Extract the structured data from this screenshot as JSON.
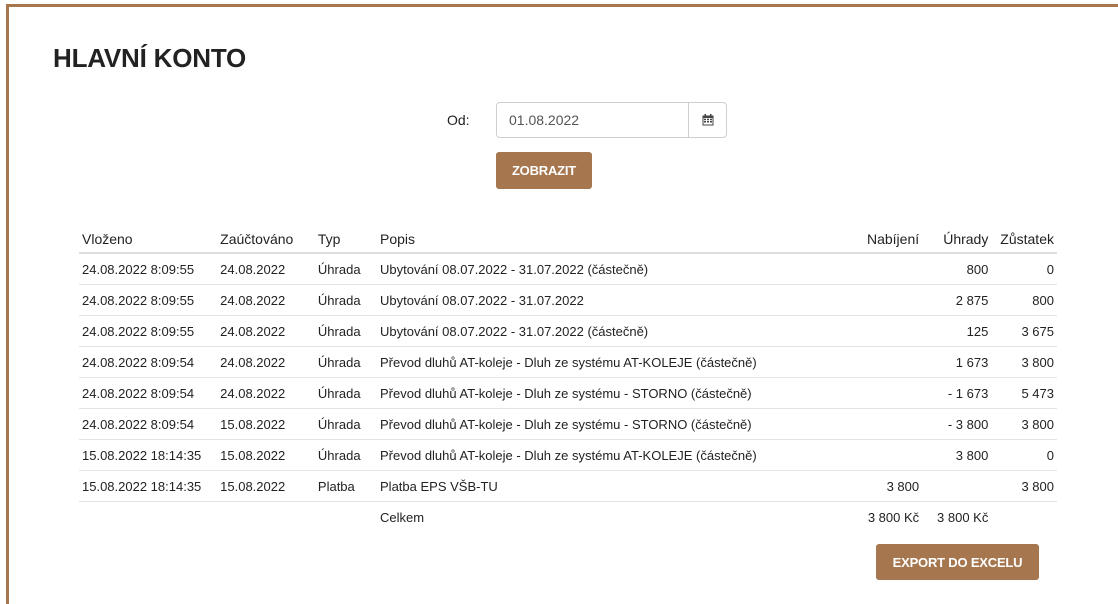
{
  "page": {
    "title": "HLAVNÍ KONTO"
  },
  "filter": {
    "from_label": "Od:",
    "from_value": "01.08.2022",
    "calendar_icon": "calendar-icon",
    "show_button": "ZOBRAZIT"
  },
  "table": {
    "columns": [
      "Vloženo",
      "Zaúčtováno",
      "Typ",
      "Popis",
      "Nabíjení",
      "Úhrady",
      "Zůstatek"
    ],
    "rows": [
      {
        "vlozeno": "24.08.2022 8:09:55",
        "zauctovano": "24.08.2022",
        "typ": "Úhrada",
        "popis": "Ubytování 08.07.2022 - 31.07.2022 (částečně)",
        "nabijeni": "",
        "uhrady": "800",
        "zustatek": "0"
      },
      {
        "vlozeno": "24.08.2022 8:09:55",
        "zauctovano": "24.08.2022",
        "typ": "Úhrada",
        "popis": "Ubytování 08.07.2022 - 31.07.2022",
        "nabijeni": "",
        "uhrady": "2 875",
        "zustatek": "800"
      },
      {
        "vlozeno": "24.08.2022 8:09:55",
        "zauctovano": "24.08.2022",
        "typ": "Úhrada",
        "popis": "Ubytování 08.07.2022 - 31.07.2022 (částečně)",
        "nabijeni": "",
        "uhrady": "125",
        "zustatek": "3 675"
      },
      {
        "vlozeno": "24.08.2022 8:09:54",
        "zauctovano": "24.08.2022",
        "typ": "Úhrada",
        "popis": "Převod dluhů AT-koleje - Dluh ze systému AT-KOLEJE (částečně)",
        "nabijeni": "",
        "uhrady": "1 673",
        "zustatek": "3 800"
      },
      {
        "vlozeno": "24.08.2022 8:09:54",
        "zauctovano": "24.08.2022",
        "typ": "Úhrada",
        "popis": "Převod dluhů AT-koleje - Dluh ze systému - STORNO (částečně)",
        "nabijeni": "",
        "uhrady": "- 1 673",
        "zustatek": "5 473"
      },
      {
        "vlozeno": "24.08.2022 8:09:54",
        "zauctovano": "15.08.2022",
        "typ": "Úhrada",
        "popis": "Převod dluhů AT-koleje - Dluh ze systému - STORNO (částečně)",
        "nabijeni": "",
        "uhrady": "- 3 800",
        "zustatek": "3 800"
      },
      {
        "vlozeno": "15.08.2022 18:14:35",
        "zauctovano": "15.08.2022",
        "typ": "Úhrada",
        "popis": "Převod dluhů AT-koleje - Dluh ze systému AT-KOLEJE (částečně)",
        "nabijeni": "",
        "uhrady": "3 800",
        "zustatek": "0"
      },
      {
        "vlozeno": "15.08.2022 18:14:35",
        "zauctovano": "15.08.2022",
        "typ": "Platba",
        "popis": "Platba EPS VŠB-TU",
        "nabijeni": "3 800",
        "uhrady": "",
        "zustatek": "3 800"
      }
    ],
    "total": {
      "label": "Celkem",
      "nabijeni": "3 800 Kč",
      "uhrady": "3 800 Kč"
    }
  },
  "export_button": "EXPORT DO EXCELU",
  "colors": {
    "accent": "#a6764f",
    "text": "#222222"
  }
}
